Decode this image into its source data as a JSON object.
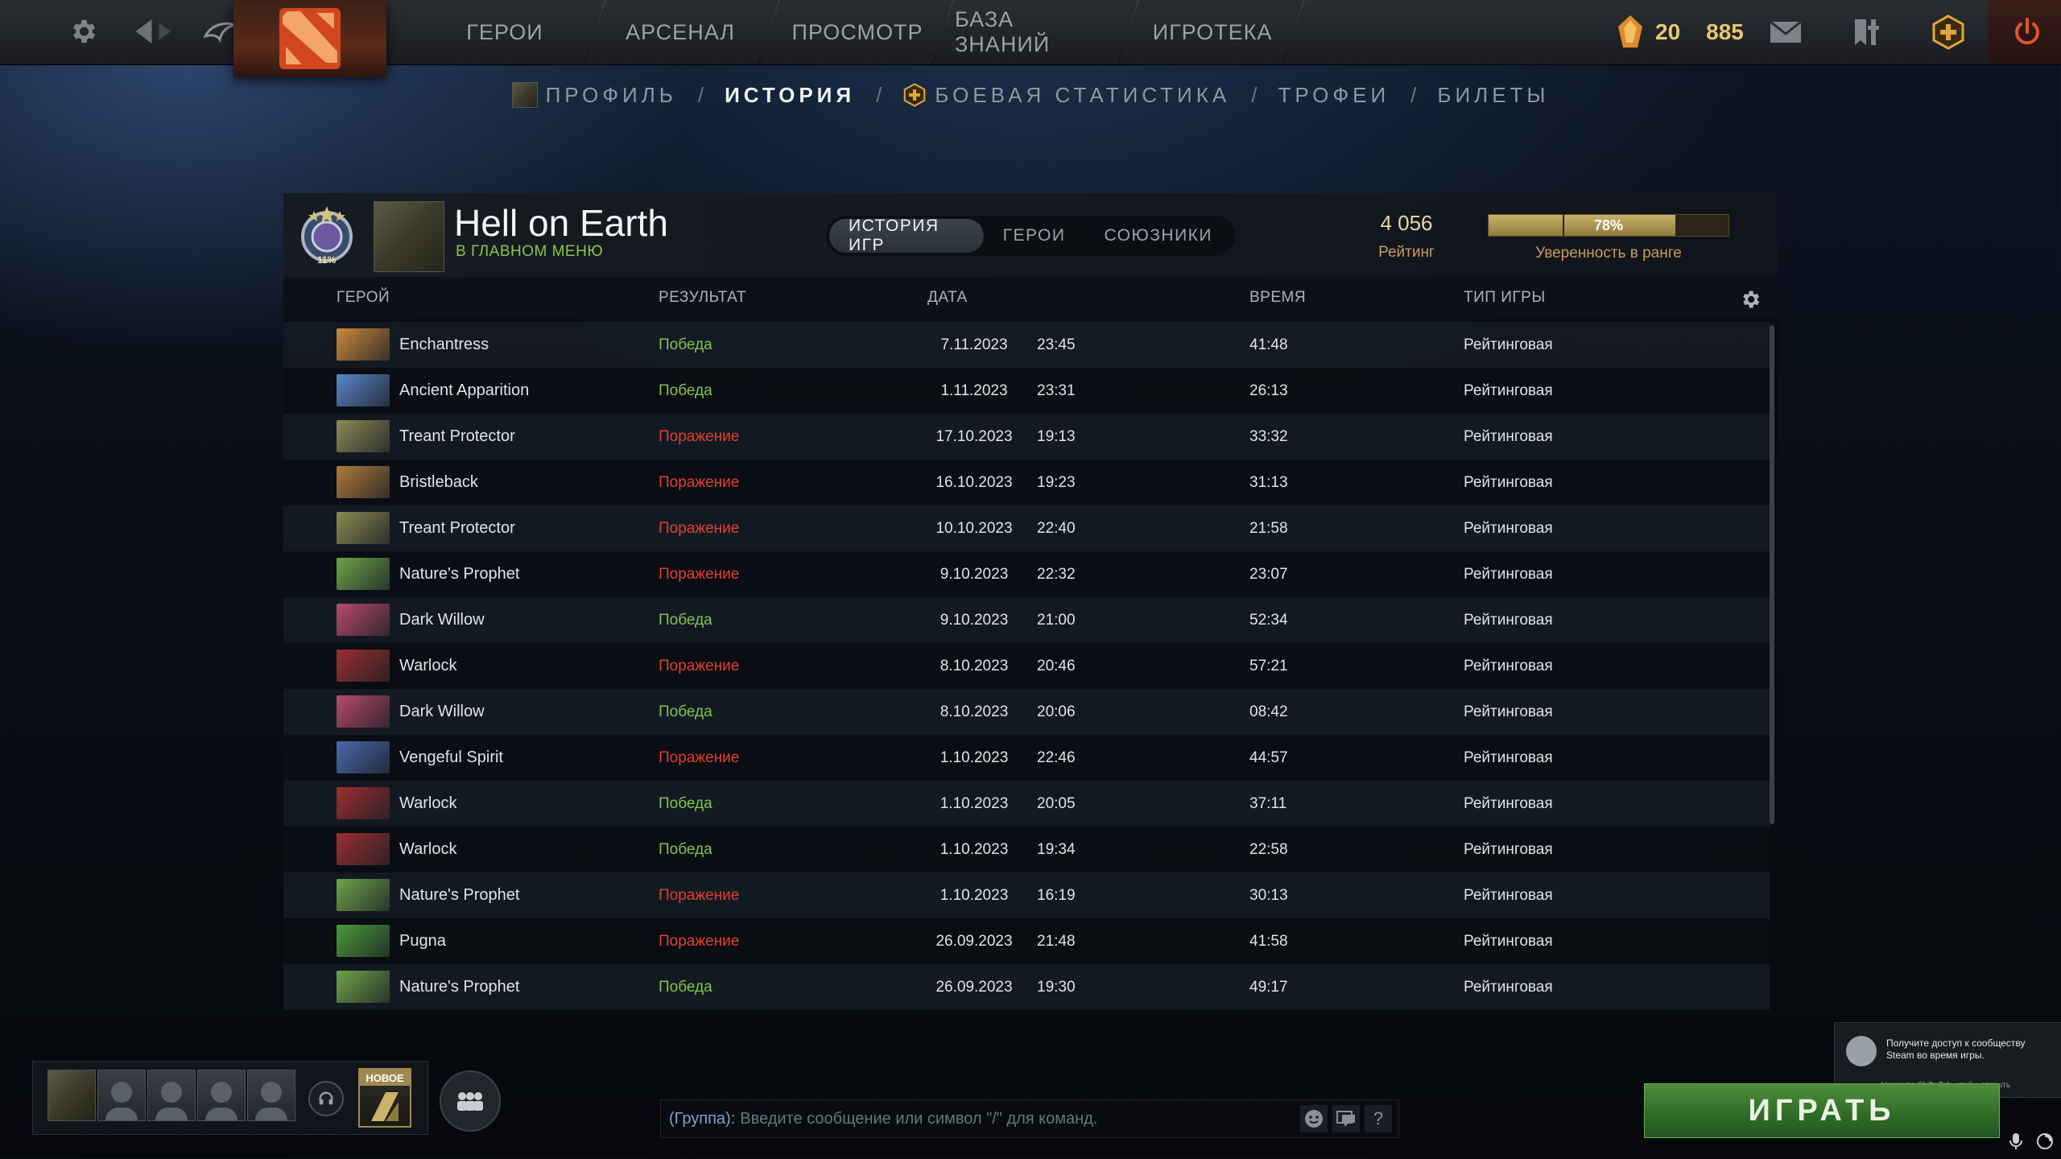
{
  "topnav": {
    "items": [
      "ГЕРОИ",
      "АРСЕНАЛ",
      "ПРОСМОТР",
      "БАЗА ЗНАНИЙ",
      "ИГРОТЕКА"
    ],
    "currency_primary": "20",
    "currency_secondary": "885"
  },
  "subnav": {
    "profile": "ПРОФИЛЬ",
    "history": "ИСТОРИЯ",
    "stats": "БОЕВАЯ СТАТИСТИКА",
    "trophies": "ТРОФЕИ",
    "tickets": "БИЛЕТЫ",
    "sep": "/"
  },
  "profile": {
    "rank_label": "11%",
    "name": "Hell on Earth",
    "status": "В ГЛАВНОМ МЕНЮ",
    "tabs": [
      "ИСТОРИЯ ИГР",
      "ГЕРОИ",
      "СОЮЗНИКИ"
    ],
    "rating_value": "4 056",
    "rating_label": "Рейтинг",
    "confidence_percent": 78,
    "confidence_text": "78%",
    "confidence_label": "Уверенность в ранге"
  },
  "columns": {
    "hero": "ГЕРОЙ",
    "result": "РЕЗУЛЬТАТ",
    "date": "ДАТА",
    "duration": "ВРЕМЯ",
    "mode": "ТИП ИГРЫ"
  },
  "matches": [
    {
      "hero": "Enchantress",
      "result": "Победа",
      "win": true,
      "date": "7.11.2023",
      "time": "23:45",
      "duration": "41:48",
      "mode": "Рейтинговая",
      "color": "#c98a3a"
    },
    {
      "hero": "Ancient Apparition",
      "result": "Победа",
      "win": true,
      "date": "1.11.2023",
      "time": "23:31",
      "duration": "26:13",
      "mode": "Рейтинговая",
      "color": "#5b86c9"
    },
    {
      "hero": "Treant Protector",
      "result": "Поражение",
      "win": false,
      "date": "17.10.2023",
      "time": "19:13",
      "duration": "33:32",
      "mode": "Рейтинговая",
      "color": "#8a8a52"
    },
    {
      "hero": "Bristleback",
      "result": "Поражение",
      "win": false,
      "date": "16.10.2023",
      "time": "19:23",
      "duration": "31:13",
      "mode": "Рейтинговая",
      "color": "#b07a3a"
    },
    {
      "hero": "Treant Protector",
      "result": "Поражение",
      "win": false,
      "date": "10.10.2023",
      "time": "22:40",
      "duration": "21:58",
      "mode": "Рейтинговая",
      "color": "#8a8a52"
    },
    {
      "hero": "Nature's Prophet",
      "result": "Поражение",
      "win": false,
      "date": "9.10.2023",
      "time": "22:32",
      "duration": "23:07",
      "mode": "Рейтинговая",
      "color": "#6ea34a"
    },
    {
      "hero": "Dark Willow",
      "result": "Победа",
      "win": true,
      "date": "9.10.2023",
      "time": "21:00",
      "duration": "52:34",
      "mode": "Рейтинговая",
      "color": "#b84a6a"
    },
    {
      "hero": "Warlock",
      "result": "Поражение",
      "win": false,
      "date": "8.10.2023",
      "time": "20:46",
      "duration": "57:21",
      "mode": "Рейтинговая",
      "color": "#9a2e2e"
    },
    {
      "hero": "Dark Willow",
      "result": "Победа",
      "win": true,
      "date": "8.10.2023",
      "time": "20:06",
      "duration": "08:42",
      "mode": "Рейтинговая",
      "color": "#b84a6a"
    },
    {
      "hero": "Vengeful Spirit",
      "result": "Поражение",
      "win": false,
      "date": "1.10.2023",
      "time": "22:46",
      "duration": "44:57",
      "mode": "Рейтинговая",
      "color": "#4a6aaa"
    },
    {
      "hero": "Warlock",
      "result": "Победа",
      "win": true,
      "date": "1.10.2023",
      "time": "20:05",
      "duration": "37:11",
      "mode": "Рейтинговая",
      "color": "#9a2e2e"
    },
    {
      "hero": "Warlock",
      "result": "Победа",
      "win": true,
      "date": "1.10.2023",
      "time": "19:34",
      "duration": "22:58",
      "mode": "Рейтинговая",
      "color": "#9a2e2e"
    },
    {
      "hero": "Nature's Prophet",
      "result": "Поражение",
      "win": false,
      "date": "1.10.2023",
      "time": "16:19",
      "duration": "30:13",
      "mode": "Рейтинговая",
      "color": "#6ea34a"
    },
    {
      "hero": "Pugna",
      "result": "Поражение",
      "win": false,
      "date": "26.09.2023",
      "time": "21:48",
      "duration": "41:58",
      "mode": "Рейтинговая",
      "color": "#4a9a3a"
    },
    {
      "hero": "Nature's Prophet",
      "result": "Победа",
      "win": true,
      "date": "26.09.2023",
      "time": "19:30",
      "duration": "49:17",
      "mode": "Рейтинговая",
      "color": "#6ea34a"
    }
  ],
  "bottom": {
    "new_badge": "НОВОЕ",
    "chat_channel": "(Группа):",
    "chat_placeholder": "Введите сообщение или символ \"/\" для команд.",
    "chat_help": "?",
    "steam_notice": "Получите доступ к сообществу Steam во время игры.",
    "steam_hint": "Нажмите Shift+Tab, чтобы открыть",
    "play_label": "ИГРАТЬ"
  }
}
